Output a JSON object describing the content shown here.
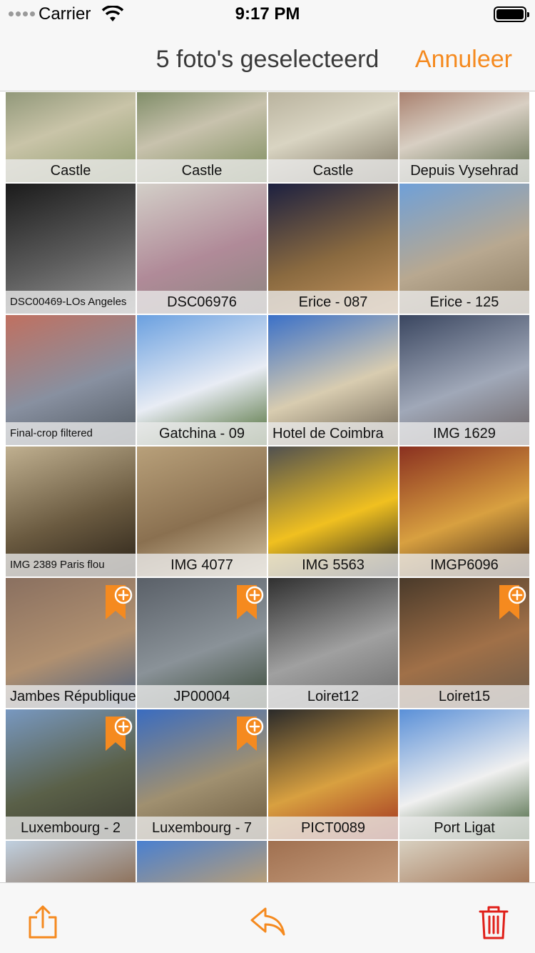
{
  "status_bar": {
    "carrier": "Carrier",
    "time": "9:17 PM"
  },
  "nav": {
    "title": "5 foto's geselecteerd",
    "cancel_label": "Annuleer"
  },
  "colors": {
    "accent": "#f58a1f",
    "caption_bg": "#ebebeb"
  },
  "photos": [
    {
      "caption": "Castle",
      "selected": false,
      "colors": [
        "#6b7a5a",
        "#c9c4a8",
        "#8d9a6c"
      ]
    },
    {
      "caption": "Castle",
      "selected": false,
      "colors": [
        "#4f6a3a",
        "#c8c2ad",
        "#7b8b5a"
      ]
    },
    {
      "caption": "Castle",
      "selected": false,
      "colors": [
        "#a49d86",
        "#d9d4c2",
        "#7b7460"
      ]
    },
    {
      "caption": "Depuis Vysehrad",
      "selected": false,
      "colors": [
        "#8a4c36",
        "#d8cfc3",
        "#5c6b4a"
      ]
    },
    {
      "caption": "DSC00469-LOs Angeles",
      "selected": false,
      "colors": [
        "#1b1b1b",
        "#5c5c5c",
        "#9a9a9a"
      ]
    },
    {
      "caption": "DSC06976",
      "selected": false,
      "colors": [
        "#d3cfc8",
        "#b08a98",
        "#8c8680"
      ]
    },
    {
      "caption": "Erice - 087",
      "selected": false,
      "colors": [
        "#1c2040",
        "#8a6a40",
        "#c89860"
      ]
    },
    {
      "caption": "Erice - 125",
      "selected": false,
      "colors": [
        "#6fa0d8",
        "#b8a890",
        "#8a7a60"
      ]
    },
    {
      "caption": "Final-crop filtered",
      "selected": false,
      "colors": [
        "#c07060",
        "#8890a0",
        "#505860"
      ]
    },
    {
      "caption": "Gatchina - 09",
      "selected": false,
      "colors": [
        "#6aa0e0",
        "#e8ecf4",
        "#4a6a30"
      ]
    },
    {
      "caption": "Hotel de Coimbra",
      "selected": false,
      "colors": [
        "#3a70c8",
        "#d8ccb0",
        "#6a6050"
      ]
    },
    {
      "caption": "IMG 1629",
      "selected": false,
      "colors": [
        "#3a4660",
        "#a0a8b8",
        "#6a6060"
      ]
    },
    {
      "caption": "IMG 2389 Paris flou",
      "selected": false,
      "colors": [
        "#c0b090",
        "#6a5a40",
        "#2a2218"
      ]
    },
    {
      "caption": "IMG 4077",
      "selected": false,
      "colors": [
        "#b8a07a",
        "#8a7050",
        "#d8c8a8"
      ]
    },
    {
      "caption": "IMG 5563",
      "selected": false,
      "colors": [
        "#505050",
        "#f0c020",
        "#202020"
      ]
    },
    {
      "caption": "IMGP6096",
      "selected": false,
      "colors": [
        "#8a3020",
        "#d8a040",
        "#402818"
      ]
    },
    {
      "caption": "Jambes République",
      "selected": true,
      "colors": [
        "#8a7060",
        "#b09070",
        "#4a6080"
      ]
    },
    {
      "caption": "JP00004",
      "selected": true,
      "colors": [
        "#5a6068",
        "#8a9298",
        "#3a4a38"
      ]
    },
    {
      "caption": "Loiret12",
      "selected": false,
      "colors": [
        "#303030",
        "#a0a0a0",
        "#6a6a6a"
      ]
    },
    {
      "caption": "Loiret15",
      "selected": true,
      "colors": [
        "#4a3a2a",
        "#a07048",
        "#6a5a4a"
      ]
    },
    {
      "caption": "Luxembourg - 2",
      "selected": true,
      "colors": [
        "#7898c0",
        "#5a6048",
        "#3a3a30"
      ]
    },
    {
      "caption": "Luxembourg - 7",
      "selected": true,
      "colors": [
        "#3a6cc0",
        "#a09070",
        "#6a5a40"
      ]
    },
    {
      "caption": "PICT0089",
      "selected": false,
      "colors": [
        "#2a2a2a",
        "#d8a040",
        "#a03020"
      ]
    },
    {
      "caption": "Port Ligat",
      "selected": false,
      "colors": [
        "#5a90d8",
        "#f0f0f0",
        "#3a5a30"
      ]
    },
    {
      "caption": "",
      "selected": false,
      "colors": [
        "#c0d0e0",
        "#8a6a50",
        "#4a4038"
      ]
    },
    {
      "caption": "",
      "selected": false,
      "colors": [
        "#4a80d0",
        "#c0a070",
        "#8a7050"
      ]
    },
    {
      "caption": "",
      "selected": false,
      "colors": [
        "#a07050",
        "#c8a080",
        "#6a4a30"
      ]
    },
    {
      "caption": "",
      "selected": false,
      "colors": [
        "#d8d0c0",
        "#a07050",
        "#3a2a20"
      ]
    }
  ],
  "toolbar": {
    "share_icon": "share-icon",
    "undo_icon": "undo-arrow-icon",
    "delete_icon": "trash-icon"
  }
}
